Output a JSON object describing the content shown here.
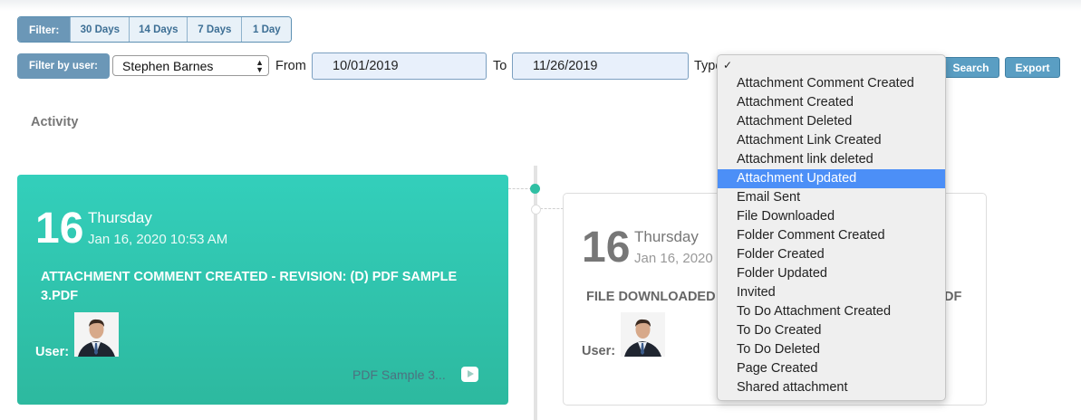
{
  "filter": {
    "label": "Filter:",
    "options": [
      "30 Days",
      "14 Days",
      "7 Days",
      "1 Day"
    ]
  },
  "user_filter": {
    "label": "Filter by user:",
    "selected": "Stephen Barnes"
  },
  "date_range": {
    "from_label": "From",
    "from_value": "10/01/2019",
    "to_label": "To",
    "to_value": "11/26/2019"
  },
  "type_filter": {
    "label_visible": "Type",
    "options": [
      "Attachment Comment Created",
      "Attachment Created",
      "Attachment Deleted",
      "Attachment Link Created",
      "Attachment link deleted",
      "Attachment Updated",
      "Email Sent",
      "File Downloaded",
      "Folder Comment Created",
      "Folder Created",
      "Folder Updated",
      "Invited",
      "To Do Attachment Created",
      "To Do Created",
      "To Do Deleted",
      "Page Created",
      "Shared attachment"
    ],
    "highlighted": "Attachment Updated",
    "check": "✓"
  },
  "actions": {
    "search": "Search",
    "export": "Export"
  },
  "activity_heading": "Activity",
  "activities": [
    {
      "day": "16",
      "weekday": "Thursday",
      "datetime": "Jan 16, 2020 10:53 AM",
      "title": "ATTACHMENT COMMENT CREATED - REVISION: (D) PDF SAMPLE 3.PDF",
      "user_label": "User:",
      "link": "PDF Sample 3..."
    },
    {
      "day": "16",
      "weekday": "Thursday",
      "datetime": "Jan 16, 2020",
      "title": "FILE DOWNLOADED",
      "title_tail": "DF",
      "user_label": "User:"
    }
  ],
  "colors": {
    "accent": "#33cfbb",
    "filter_blue": "#6b97b7",
    "button_blue": "#5a9ec3",
    "highlight": "#4c8ff7"
  }
}
